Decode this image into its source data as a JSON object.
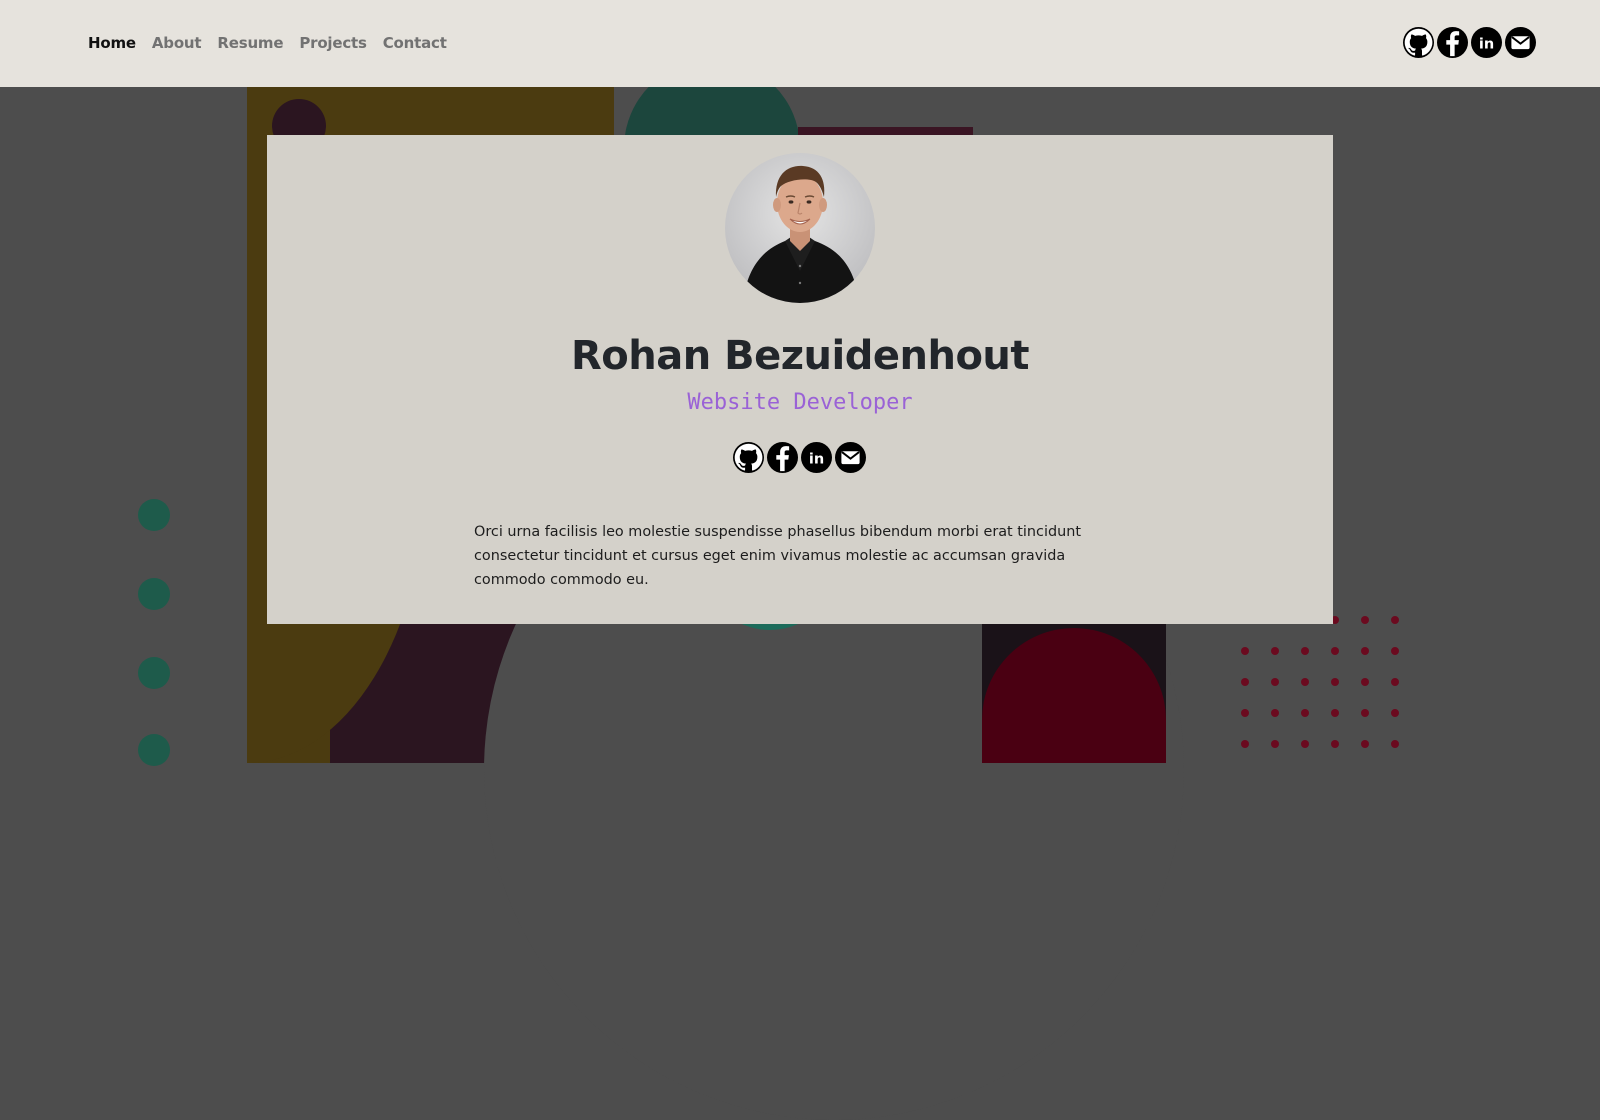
{
  "nav": {
    "items": [
      {
        "label": "Home",
        "active": true
      },
      {
        "label": "About",
        "active": false
      },
      {
        "label": "Resume",
        "active": false
      },
      {
        "label": "Projects",
        "active": false
      },
      {
        "label": "Contact",
        "active": false
      }
    ]
  },
  "social_icons": [
    "github-icon",
    "facebook-icon",
    "linkedin-icon",
    "mail-icon"
  ],
  "profile": {
    "name": "Rohan Bezuidenhout",
    "role": "Website Developer",
    "bio": "Orci urna facilisis leo molestie suspendisse phasellus bibendum morbi erat tincidunt consectetur tincidunt et cursus eget enim vivamus molestie ac accumsan gravida commodo commodo eu."
  },
  "colors": {
    "header_bg": "#e6e3dd",
    "page_bg": "#4d4d4d",
    "card_bg": "#d4d1ca",
    "accent": "#9a62d6",
    "name_text": "#22262b"
  }
}
